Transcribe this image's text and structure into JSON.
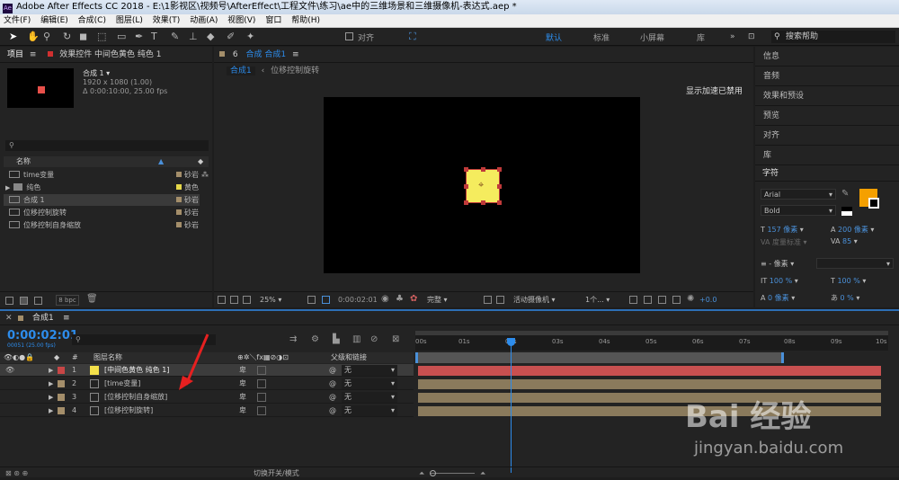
{
  "titlebar": {
    "logo": "Ae",
    "text": "Adobe After Effects CC 2018 - E:\\1影视区\\视频号\\AfterEffect\\工程文件\\练习\\ae中的三维场景和三维摄像机-表达式.aep *"
  },
  "menu": [
    "文件(F)",
    "编辑(E)",
    "合成(C)",
    "图层(L)",
    "效果(T)",
    "动画(A)",
    "视图(V)",
    "窗口",
    "帮助(H)"
  ],
  "toolbar": {
    "align_label": "对齐",
    "workspaces": [
      {
        "label": "默认",
        "active": true
      },
      {
        "label": "标准",
        "active": false
      },
      {
        "label": "小屏幕",
        "active": false
      },
      {
        "label": "库",
        "active": false
      }
    ],
    "search_placeholder": "搜索帮助"
  },
  "project": {
    "tab_project": "项目",
    "tab_effects": "效果控件 中间色黄色 纯色 1",
    "comp_name": "合成 1",
    "comp_dims": "1920 x 1080 (1.00)",
    "comp_dur": "Δ 0:00:10:00, 25.00 fps",
    "col_name": "名称",
    "items": [
      {
        "name": "time变量",
        "type": "composition",
        "label_color": "#a48e6a",
        "label": "砂岩",
        "selected": false
      },
      {
        "name": "纯色",
        "type": "folder",
        "label_color": "#e6d84a",
        "label": "黄色",
        "selected": false
      },
      {
        "name": "合成 1",
        "type": "composition",
        "label_color": "#a48e6a",
        "label": "砂岩",
        "selected": true
      },
      {
        "name": "位移控制旋转",
        "type": "composition",
        "label_color": "#a48e6a",
        "label": "砂岩",
        "selected": false
      },
      {
        "name": "位移控制自身缩放",
        "type": "composition",
        "label_color": "#a48e6a",
        "label": "砂岩",
        "selected": false
      }
    ],
    "bpc": "8 bpc"
  },
  "viewer": {
    "tab": "合成 合成1",
    "breadcrumb_active": "合成1",
    "breadcrumb_next": "位移控制旋转",
    "accel_text": "显示加速已禁用",
    "zoom": "25%",
    "timecode": "0:00:02:01",
    "resolution": "完整",
    "camera": "活动摄像机",
    "views": "1个...",
    "exposure": "+0.0"
  },
  "right_panels": [
    "信息",
    "音频",
    "效果和预设",
    "预览",
    "对齐",
    "库"
  ],
  "character": {
    "title": "字符",
    "font": "Arial",
    "style": "Bold",
    "size": "157 像素",
    "leading": "200 像素",
    "kerning": "度量标准",
    "tracking": "85",
    "stroke_width": "- 像素",
    "vscale": "100 %",
    "hscale": "100 %",
    "baseline": "0 像素",
    "tsume": "0 %",
    "fill_color": "#f5a000"
  },
  "timeline": {
    "tab": "合成1",
    "timecode": "0:00:02:01",
    "frames": "00051 (25.00 fps)",
    "col_layer_name": "图层名称",
    "col_parent": "父级和链接",
    "ruler": [
      "00s",
      "01s",
      "02s",
      "03s",
      "04s",
      "05s",
      "06s",
      "07s",
      "08s",
      "09s",
      "10s"
    ],
    "layers": [
      {
        "num": "1",
        "name": "[中间色黄色 纯色 1]",
        "label_color": "#c84646",
        "swatch": "#f3e04a",
        "parent": "无",
        "selected": true
      },
      {
        "num": "2",
        "name": "[time变量]",
        "label_color": "#a48e6a",
        "swatch": "#a48e6a",
        "parent": "无",
        "selected": false
      },
      {
        "num": "3",
        "name": "[位移控制自身缩放]",
        "label_color": "#a48e6a",
        "swatch": "#a48e6a",
        "parent": "无",
        "selected": false
      },
      {
        "num": "4",
        "name": "[位移控制旋转]",
        "label_color": "#a48e6a",
        "swatch": "#a48e6a",
        "parent": "无",
        "selected": false
      }
    ],
    "footer": "切换开关/模式"
  },
  "watermark": {
    "brand": "Bai 经验",
    "url": "jingyan.baidu.com"
  }
}
